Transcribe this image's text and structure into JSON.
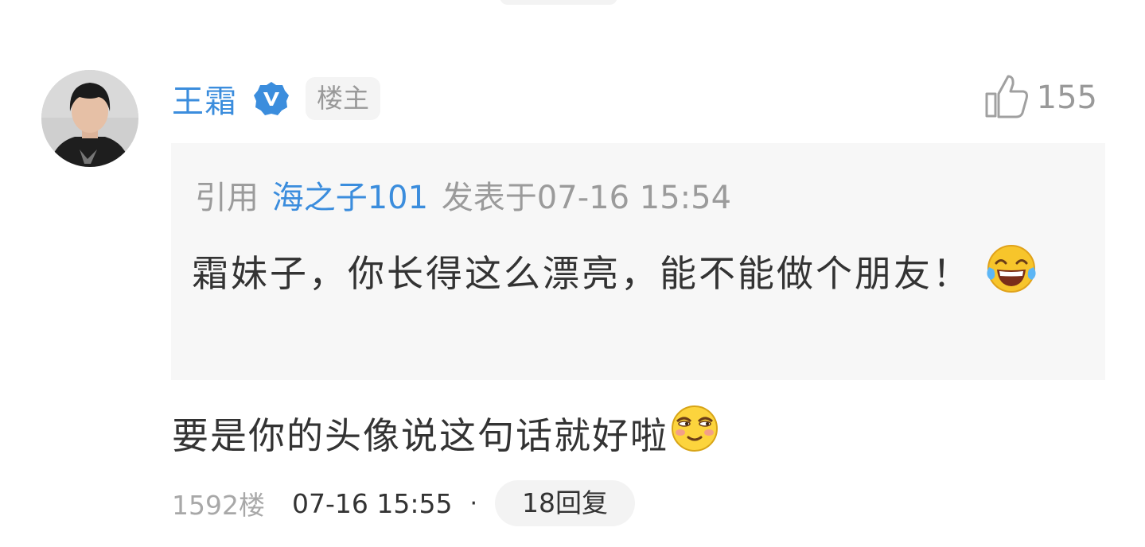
{
  "comment": {
    "author": "王霜",
    "badge": "楼主",
    "likes": "155",
    "quote": {
      "prefix": "引用",
      "user": "海之子101",
      "posted_at": "发表于07-16 15:54",
      "text": "霜妹子，你长得这么漂亮，能不能做个朋友！"
    },
    "reply_text": "要是你的头像说这句话就好啦",
    "floor": "1592楼",
    "time": "07-16 15:55",
    "separator": "·",
    "reply_count": "18回复"
  },
  "icons": {
    "verified": "verified-v-icon",
    "like": "thumbs-up-icon",
    "laugh_emoji": "tears-of-joy-emoji",
    "smug_emoji": "smirk-emoji"
  },
  "colors": {
    "link_blue": "#3b8ddd",
    "muted_gray": "#999999",
    "quote_bg": "#f7f7f7"
  }
}
